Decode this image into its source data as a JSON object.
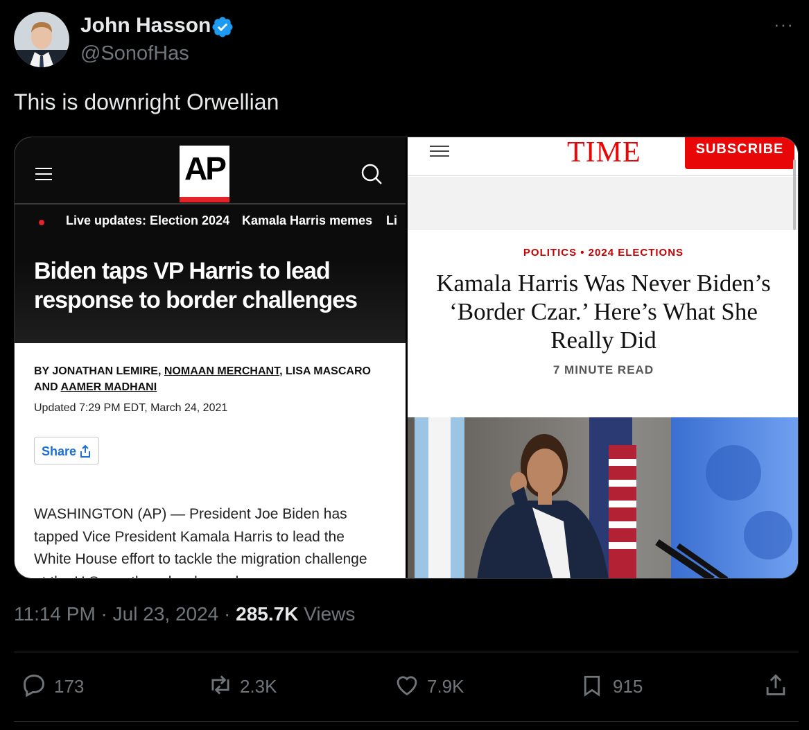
{
  "author": {
    "display_name": "John Hasson",
    "handle": "@SonofHas",
    "verified": true
  },
  "more_icon": "···",
  "tweet_text": "This is downright Orwellian",
  "ap_article": {
    "logo": "AP",
    "nav": [
      "Live updates: Election 2024",
      "Kamala Harris memes",
      "Li"
    ],
    "headline": "Biden taps VP Harris to lead response to border challenges",
    "byline": {
      "by": "BY JONATHAN LEMIRE, ",
      "author2": "NOMAAN MERCHANT",
      "mid": ", LISA MASCARO AND ",
      "author4": "AAMER MADHANI"
    },
    "updated": "Updated 7:29 PM EDT, March 24, 2021",
    "share_label": "Share",
    "body": "WASHINGTON (AP) — President Joe Biden has tapped Vice President Kamala Harris to lead the White House effort to tackle the migration challenge at the U.S.-southern border and"
  },
  "time_article": {
    "logo": "TIME",
    "subscribe_label": "SUBSCRIBE",
    "kicker": "POLITICS • 2024 ELECTIONS",
    "headline": "Kamala Harris Was Never Biden’s ‘Border Czar.’ Here’s What She Really Did",
    "read_time": "7 MINUTE READ"
  },
  "meta": {
    "time": "11:14 PM",
    "separator": " · ",
    "date": "Jul 23, 2024",
    "views_count": "285.7K",
    "views_label": " Views"
  },
  "actions": {
    "replies": "173",
    "reposts": "2.3K",
    "likes": "7.9K",
    "bookmarks": "915"
  },
  "colors": {
    "background": "#000000",
    "text": "#e7e9ea",
    "secondary": "#71767b",
    "verified": "#1d9bf0",
    "ap_red": "#e2232a",
    "time_red": "#e90606"
  }
}
